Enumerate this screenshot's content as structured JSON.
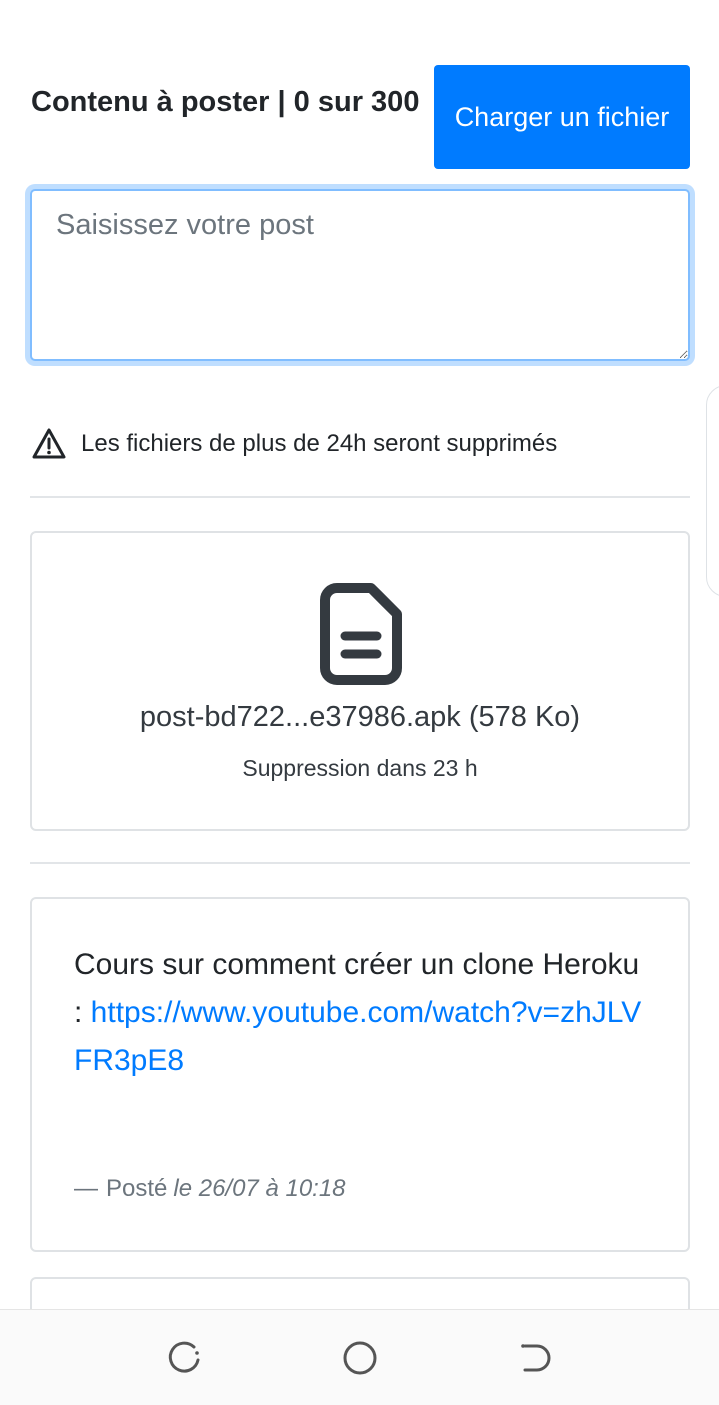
{
  "composer": {
    "title": "Contenu à poster | 0 sur 300",
    "upload_label": "Charger un fichier",
    "placeholder": "Saisissez votre post",
    "value": ""
  },
  "notice": {
    "icon": "warning-triangle-icon",
    "text": "Les fichiers de plus de 24h seront supprimés"
  },
  "file_post": {
    "icon": "file-document-icon",
    "filename": "post-bd722...e37986.apk (578 Ko)",
    "expiry": "Suppression dans 23 h"
  },
  "text_post": {
    "text": "Cours sur comment créer un clone Heroku : ",
    "link": "https://www.youtube.com/watch?v=zhJLVFR3pE8",
    "meta_dash": "—",
    "meta_prefix": "Posté",
    "meta_time": "le 26/07 à 10:18"
  },
  "navbar": {
    "recent_icon": "recent-apps-icon",
    "home_icon": "home-circle-icon",
    "back_icon": "back-icon"
  },
  "colors": {
    "primary": "#007bff",
    "text": "#212529",
    "muted": "#6c757d",
    "border": "#dfe2e5"
  }
}
